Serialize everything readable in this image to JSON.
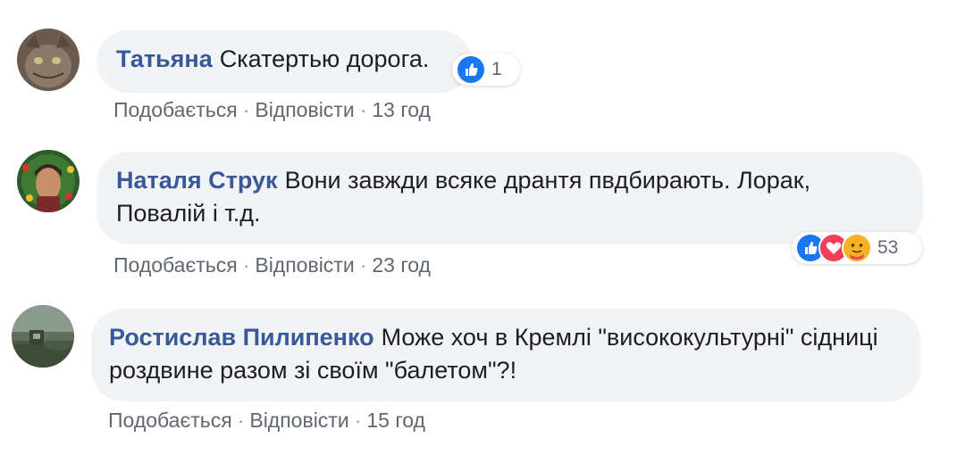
{
  "colors": {
    "author": "#385898",
    "bubble_bg": "#f2f3f5",
    "meta": "#616770",
    "like_blue": "#1877f2",
    "love_red": "#f33e58",
    "care_yellow": "#f7b125"
  },
  "comments": [
    {
      "author": "Татьяна",
      "text": "Скатертью дорога.",
      "actions": {
        "like": "Подобається",
        "reply": "Відповісти",
        "time": "13 год"
      },
      "reactions": {
        "icons": [
          "like-icon"
        ],
        "count": "1"
      }
    },
    {
      "author": "Наталя Струк",
      "text": "Вони завжди всяке дрантя пвдбирають. Лорак, Повалій і т.д.",
      "actions": {
        "like": "Подобається",
        "reply": "Відповісти",
        "time": "23 год"
      },
      "reactions": {
        "icons": [
          "like-icon",
          "love-icon",
          "care-icon"
        ],
        "count": "53"
      }
    },
    {
      "author": "Ростислав Пилипенко",
      "text": "Може хоч в Кремлі \"висококультурні\" сідниці роздвине разом зі своїм \"балетом\"?!",
      "actions": {
        "like": "Подобається",
        "reply": "Відповісти",
        "time": "15 год"
      },
      "reactions": null
    }
  ],
  "separator": "·"
}
